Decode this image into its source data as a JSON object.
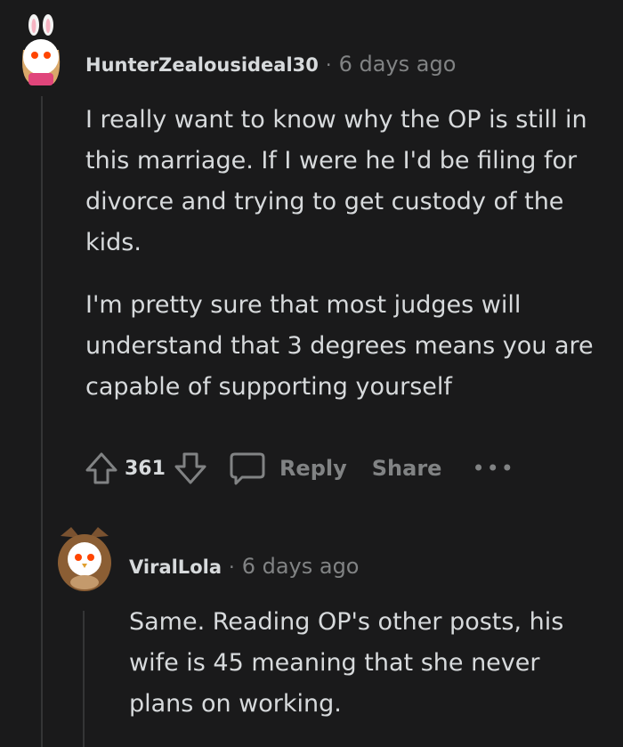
{
  "comments": [
    {
      "username": "HunterZealousideal30",
      "separator": "·",
      "time": "6 days ago",
      "paragraphs": [
        "I really want to know why the OP is still in this marriage. If I were he I'd be filing for divorce and trying to get custody of the kids.",
        "I'm pretty sure that most judges will understand that 3 degrees means you are capable of supporting yourself"
      ],
      "score": "361",
      "reply_label": "Reply",
      "share_label": "Share",
      "more_label": "•••",
      "avatar_icon": "bunny-avatar-icon"
    },
    {
      "username": "ViralLola",
      "separator": "·",
      "time": "6 days ago",
      "paragraphs": [
        "Same. Reading OP's other posts, his wife is 45 meaning that she never plans on working."
      ],
      "avatar_icon": "owl-avatar-icon"
    }
  ],
  "colors": {
    "background": "#1a1a1b",
    "text": "#d7dadc",
    "muted": "#818384",
    "thread_line": "#343536"
  }
}
